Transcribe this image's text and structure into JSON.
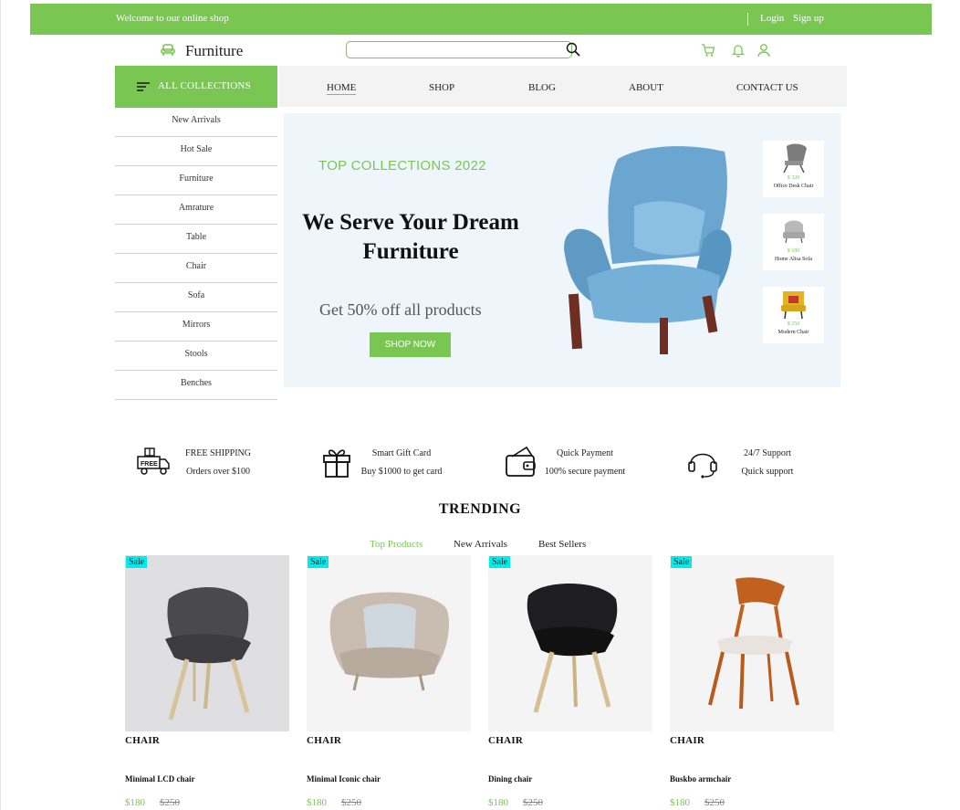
{
  "topbar": {
    "welcome": "Welcome to our online shop",
    "login": "Login",
    "signup": "Sign up"
  },
  "header": {
    "logo": "Furniture",
    "search_placeholder": "",
    "icons": [
      "sofa-icon",
      "search-icon",
      "cart-icon",
      "bell-icon",
      "user-icon"
    ]
  },
  "nav": {
    "all_collections": "ALL COLLECTIONS",
    "items": [
      "HOME",
      "SHOP",
      "BLOG",
      "ABOUT",
      "CONTACT US"
    ]
  },
  "categories": [
    "New Arrivals",
    "Hot Sale",
    "Furniture",
    "Amrature",
    "Table",
    "Chair",
    "Sofa",
    "Mirrors",
    "Stools",
    "Benches"
  ],
  "hero": {
    "kicker": "TOP COLLECTIONS 2022",
    "headline_line1": "We Serve Your Dream",
    "headline_line2": "Furniture",
    "offer": "Get 50% off all products",
    "button": "SHOP NOW",
    "mini_products": [
      {
        "price": "$ 320",
        "name": "Office Desk Chair"
      },
      {
        "price": "$ 180",
        "name": "Home Alisa Sofa"
      },
      {
        "price": "$ 250",
        "name": "Modern Chair"
      }
    ]
  },
  "features": [
    {
      "title": "FREE SHIPPING",
      "subtitle": "Orders over $100",
      "icon": "delivery-truck-icon"
    },
    {
      "title": "Smart Gift Card",
      "subtitle": "Buy $1000 to get card",
      "icon": "gift-icon"
    },
    {
      "title": "Quick Payment",
      "subtitle": "100% secure payment",
      "icon": "wallet-icon"
    },
    {
      "title": "24/7 Support",
      "subtitle": "Quick support",
      "icon": "headset-icon"
    }
  ],
  "trending": {
    "title": "TRENDING",
    "tabs": [
      "Top Products",
      "New Arrivals",
      "Best Sellers"
    ],
    "active_tab": "Top Products",
    "products": [
      {
        "badge": "Sale",
        "category": "CHAIR",
        "name": "Minimal LCD chair",
        "price": "$180",
        "old_price": "$250"
      },
      {
        "badge": "Sale",
        "category": "CHAIR",
        "name": "Minimal Iconic chair",
        "price": "$180",
        "old_price": "$250"
      },
      {
        "badge": "Sale",
        "category": "CHAIR",
        "name": "Dining chair",
        "price": "$180",
        "old_price": "$250"
      },
      {
        "badge": "Sale",
        "category": "CHAIR",
        "name": "Buskbo armchair",
        "price": "$180",
        "old_price": "$250"
      }
    ]
  },
  "colors": {
    "brand": "#7ac653",
    "sale_badge": "#00ecec",
    "hero_bg": "#eef6fc"
  }
}
